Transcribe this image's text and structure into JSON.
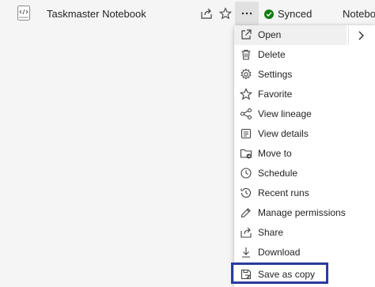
{
  "header": {
    "title": "Taskmaster Notebook",
    "sync_status": "Synced",
    "next_item_label": "Notebool"
  },
  "menu": {
    "items": [
      {
        "label": "Open",
        "icon": "open-external-icon"
      },
      {
        "label": "Delete",
        "icon": "trash-icon"
      },
      {
        "label": "Settings",
        "icon": "gear-icon"
      },
      {
        "label": "Favorite",
        "icon": "star-icon"
      },
      {
        "label": "View lineage",
        "icon": "lineage-icon"
      },
      {
        "label": "View details",
        "icon": "details-icon"
      },
      {
        "label": "Move to",
        "icon": "folder-move-icon"
      },
      {
        "label": "Schedule",
        "icon": "clock-icon"
      },
      {
        "label": "Recent runs",
        "icon": "history-icon"
      },
      {
        "label": "Manage permissions",
        "icon": "edit-icon"
      },
      {
        "label": "Share",
        "icon": "share-icon"
      },
      {
        "label": "Download",
        "icon": "download-icon"
      },
      {
        "label": "Save as copy",
        "icon": "save-copy-icon"
      }
    ]
  },
  "colors": {
    "sync_green": "#107c10",
    "highlight_border": "#2b3b9e",
    "hover_bg": "#f0f0f0"
  }
}
